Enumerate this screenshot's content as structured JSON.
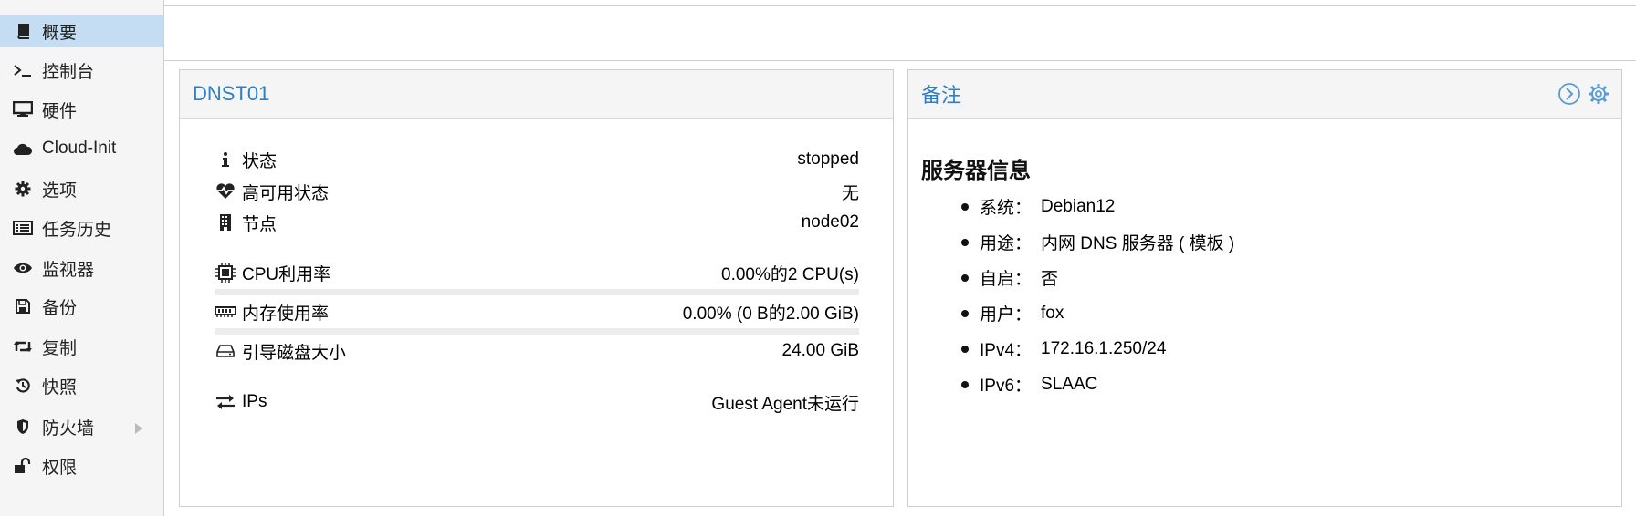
{
  "sidebar": {
    "items": [
      {
        "label": "概要",
        "icon": "book-icon",
        "active": true
      },
      {
        "label": "控制台",
        "icon": "terminal-icon"
      },
      {
        "label": "硬件",
        "icon": "monitor-icon"
      },
      {
        "label": "Cloud-Init",
        "icon": "cloud-icon"
      },
      {
        "label": "选项",
        "icon": "gear-icon"
      },
      {
        "label": "任务历史",
        "icon": "list-icon"
      },
      {
        "label": "监视器",
        "icon": "eye-icon"
      },
      {
        "label": "备份",
        "icon": "floppy-icon"
      },
      {
        "label": "复制",
        "icon": "retweet-icon"
      },
      {
        "label": "快照",
        "icon": "history-icon"
      },
      {
        "label": "防火墙",
        "icon": "shield-icon"
      },
      {
        "label": "权限",
        "icon": "unlock-icon"
      }
    ]
  },
  "summary": {
    "title": "DNST01",
    "status_label": "状态",
    "status_value": "stopped",
    "ha_label": "高可用状态",
    "ha_value": "无",
    "node_label": "节点",
    "node_value": "node02",
    "cpu_label": "CPU利用率",
    "cpu_value": "0.00%的2 CPU(s)",
    "mem_label": "内存使用率",
    "mem_value": "0.00% (0 B的2.00 GiB)",
    "disk_label": "引导磁盘大小",
    "disk_value": "24.00 GiB",
    "ips_label": "IPs",
    "ips_value": "Guest Agent未运行"
  },
  "notes": {
    "title": "备注",
    "heading": "服务器信息",
    "items": [
      {
        "key": "系统：",
        "value": "Debian12"
      },
      {
        "key": "用途：",
        "value": "内网 DNS 服务器 ( 模板 )"
      },
      {
        "key": "自启：",
        "value": "否"
      },
      {
        "key": "用户：",
        "value": "fox"
      },
      {
        "key": "IPv4：",
        "value": "172.16.1.250/24"
      },
      {
        "key": "IPv6：",
        "value": "SLAAC"
      }
    ]
  },
  "colors": {
    "accent": "#2d7fc1",
    "active_bg": "#c5ddf2"
  }
}
